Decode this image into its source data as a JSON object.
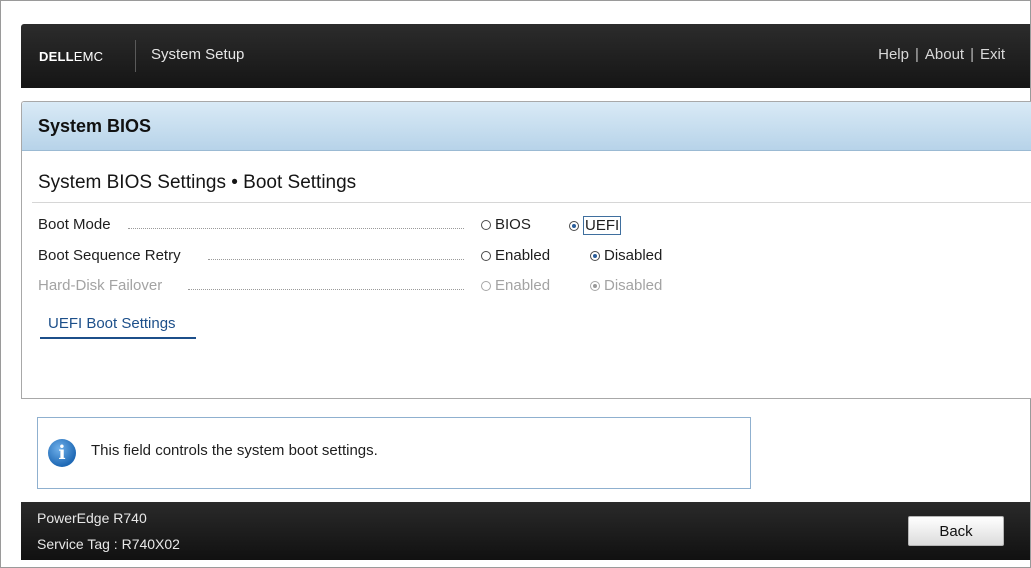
{
  "header": {
    "logo_bold": "DELL",
    "logo_rest": "EMC",
    "title": "System Setup",
    "links": {
      "help": "Help",
      "about": "About",
      "exit": "Exit",
      "sep": "|"
    }
  },
  "panel": {
    "title": "System BIOS",
    "breadcrumb": "System BIOS Settings • Boot Settings"
  },
  "settings": [
    {
      "label": "Boot Mode",
      "options": [
        "BIOS",
        "UEFI"
      ],
      "selected": "UEFI",
      "enabled": true,
      "focused": true
    },
    {
      "label": "Boot Sequence Retry",
      "options": [
        "Enabled",
        "Disabled"
      ],
      "selected": "Disabled",
      "enabled": true,
      "focused": false
    },
    {
      "label": "Hard-Disk Failover",
      "options": [
        "Enabled",
        "Disabled"
      ],
      "selected": "Disabled",
      "enabled": false,
      "focused": false
    }
  ],
  "link": {
    "label": "UEFI Boot Settings"
  },
  "help": {
    "icon": "info-icon",
    "glyph": "i",
    "text": "This field controls the system boot settings."
  },
  "footer": {
    "model": "PowerEdge R740",
    "service_tag_label": "Service Tag",
    "service_tag_value": "R740X02",
    "back_label": "Back"
  },
  "colors": {
    "header_bg": "#1f1f1f",
    "panel_header": "#c6ddef",
    "link": "#1c4f8a",
    "radio_selected": "#2a5d9a",
    "disabled_text": "#a3a3a3"
  }
}
